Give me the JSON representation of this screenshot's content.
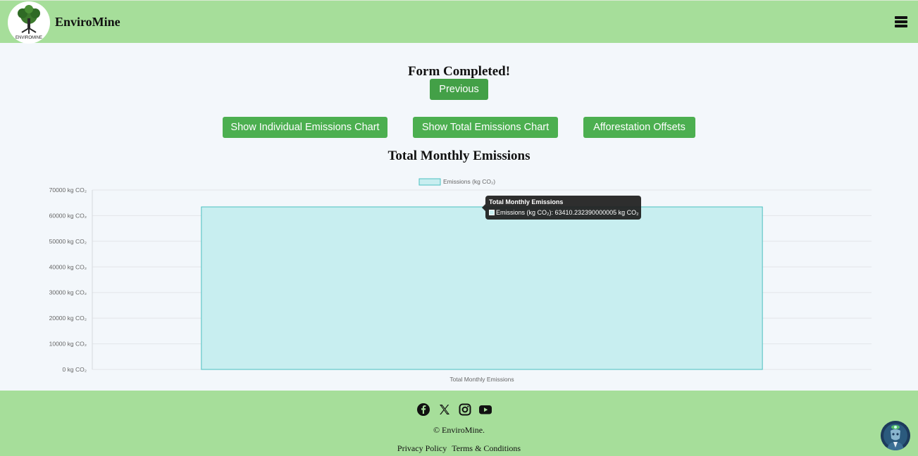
{
  "header": {
    "brand": "EnviroMine",
    "logo_text": "ENVIROMINE"
  },
  "main": {
    "form_title": "Form Completed!",
    "previous_label": "Previous",
    "buttons": {
      "individual": "Show Individual Emissions Chart",
      "total": "Show Total Emissions Chart",
      "afforestation": "Afforestation Offsets"
    },
    "chart_heading": "Total Monthly Emissions"
  },
  "chart_data": {
    "type": "bar",
    "categories": [
      "Total Monthly Emissions"
    ],
    "series": [
      {
        "name": "Emissions (kg CO₂)",
        "values": [
          63410.232390000005
        ]
      }
    ],
    "ylim": [
      0,
      70000
    ],
    "y_ticks": [
      "0 kg CO₂",
      "10000 kg CO₂",
      "20000 kg CO₂",
      "30000 kg CO₂",
      "40000 kg CO₂",
      "50000 kg CO₂",
      "60000 kg CO₂",
      "70000 kg CO₂"
    ],
    "grid": true,
    "legend": "top",
    "colors": {
      "fill": "#c8eef0",
      "stroke": "#4bc0c0"
    }
  },
  "tooltip": {
    "title": "Total Monthly Emissions",
    "row": "Emissions (kg CO₂): 63410.232390000005 kg CO₂"
  },
  "footer": {
    "social_icons": [
      "facebook-icon",
      "x-icon",
      "instagram-icon",
      "youtube-icon"
    ],
    "copyright": "© EnviroMine.",
    "links": {
      "privacy": "Privacy Policy",
      "terms": "Terms & Conditions"
    }
  },
  "colors": {
    "header_bg": "#a6de9a",
    "button_green": "#4caf50",
    "page_bg": "#f3f7fb"
  }
}
